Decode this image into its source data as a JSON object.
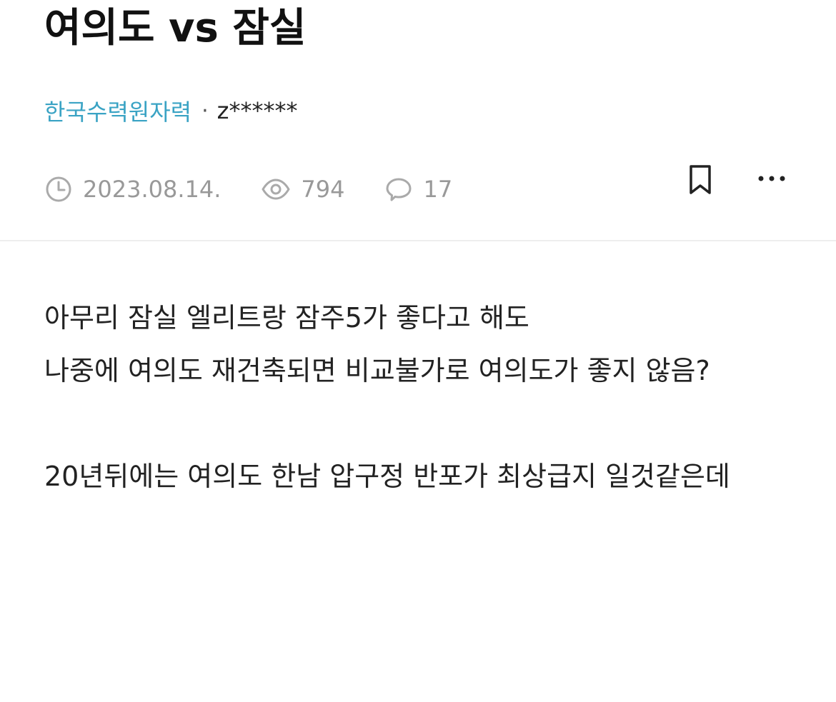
{
  "post": {
    "title": "여의도 vs 잠실",
    "company": "한국수력원자력",
    "separator": "·",
    "username": "z******",
    "date": "2023.08.14.",
    "views": "794",
    "comments": "17",
    "body_paragraphs": [
      "아무리 잠실 엘리트랑 잠주5가 좋다고 해도\n나중에 여의도 재건축되면 비교불가로 여의도가 좋지 않음?",
      "20년뒤에는 여의도 한남 압구정 반포가 최상급지 일것같은데"
    ]
  },
  "icons": {
    "date": "clock-icon",
    "views": "eye-icon",
    "comments": "speech-bubble-icon",
    "bookmark": "bookmark-icon",
    "more": "more-dots-icon"
  },
  "colors": {
    "company": "#3aa3c4",
    "meta": "#999999",
    "text": "#222222",
    "divider": "#eeeeee"
  }
}
